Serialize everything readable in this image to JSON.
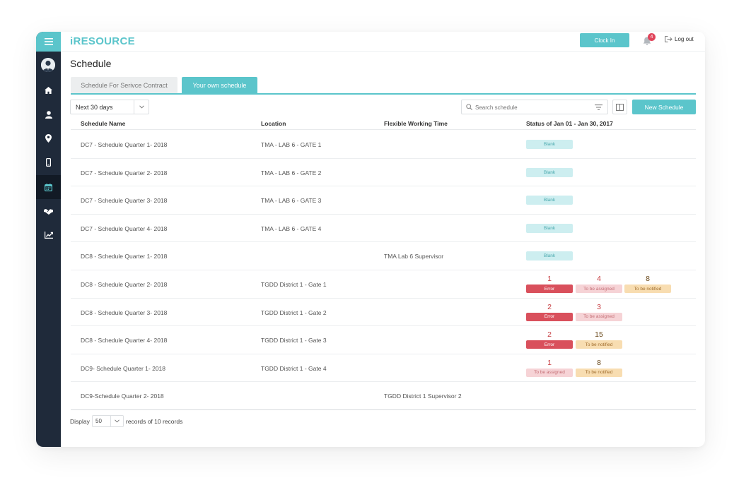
{
  "header": {
    "logo": "iRESOURCE",
    "clock_in_label": "Clock In",
    "notification_count": "4",
    "logout_label": "Log out"
  },
  "sidebar": {
    "icons": [
      "menu-icon",
      "avatar",
      "home-icon",
      "user-icon",
      "location-pin-icon",
      "mobile-icon",
      "calendar-icon",
      "handshake-icon",
      "chart-icon"
    ],
    "active": "calendar-icon"
  },
  "page": {
    "title": "Schedule",
    "tabs": [
      {
        "label": "Schedule For Serivce Contract",
        "active": false
      },
      {
        "label": "Your own schedule",
        "active": true
      }
    ],
    "range_select": "Next 30 days",
    "search_placeholder": "Search schedule",
    "new_button": "New Schedule"
  },
  "table": {
    "columns": [
      "Schedule Name",
      "Location",
      "Flexible Working Time",
      "Status of Jan 01 - Jan 30, 2017"
    ],
    "rows": [
      {
        "name": "DC7 - Schedule Quarter 1- 2018",
        "location": "TMA - LAB 6 - GATE 1",
        "flex": "",
        "blank": "Blank"
      },
      {
        "name": "DC7 - Schedule Quarter 2- 2018",
        "location": "TMA - LAB 6 - GATE 2",
        "flex": "",
        "blank": "Blank"
      },
      {
        "name": "DC7 - Schedule Quarter 3- 2018",
        "location": "TMA - LAB 6 - GATE 3",
        "flex": "",
        "blank": "Blank"
      },
      {
        "name": "DC7 - Schedule Quarter 4- 2018",
        "location": "TMA - LAB 6 - GATE 4",
        "flex": "",
        "blank": "Blank"
      },
      {
        "name": "DC8 - Schedule Quarter 1- 2018",
        "location": "",
        "flex": "TMA Lab 6 Supervisor",
        "blank": "Blank"
      },
      {
        "name": "DC8 - Schedule Quarter 2- 2018",
        "location": "TGDD District 1 - Gate 1",
        "flex": "",
        "statuses": [
          {
            "count": "1",
            "label": "Error",
            "type": "error"
          },
          {
            "count": "4",
            "label": "To be assigned",
            "type": "assign"
          },
          {
            "count": "8",
            "label": "To be notified",
            "type": "notify"
          }
        ]
      },
      {
        "name": "DC8 - Schedule Quarter 3- 2018",
        "location": "TGDD District 1 - Gate 2",
        "flex": "",
        "statuses": [
          {
            "count": "2",
            "label": "Error",
            "type": "error"
          },
          {
            "count": "3",
            "label": "To be assigned",
            "type": "assign"
          }
        ]
      },
      {
        "name": "DC8 - Schedule Quarter 4- 2018",
        "location": "TGDD District 1 - Gate 3",
        "flex": "",
        "statuses": [
          {
            "count": "2",
            "label": "Error",
            "type": "error"
          },
          {
            "count": "15",
            "label": "To be notified",
            "type": "notify"
          }
        ]
      },
      {
        "name": "DC9- Schedule Quarter 1- 2018",
        "location": "TGDD District 1 - Gate 4",
        "flex": "",
        "statuses": [
          {
            "count": "1",
            "label": "To be assigned",
            "type": "assign"
          },
          {
            "count": "8",
            "label": "To be notified",
            "type": "notify"
          }
        ]
      },
      {
        "name": "DC9-Schedule Quarter 2- 2018",
        "location": "",
        "flex": "TGDD District 1 Supervisor 2"
      }
    ]
  },
  "footer": {
    "display_label": "Display",
    "per_page": "50",
    "records_label": "records of 10 records"
  },
  "colors": {
    "accent": "#5bc5cb",
    "sidebar": "#1f2a3a",
    "error": "#d9505c",
    "assign": "#f6d3d6",
    "notify": "#f8ddb1"
  }
}
